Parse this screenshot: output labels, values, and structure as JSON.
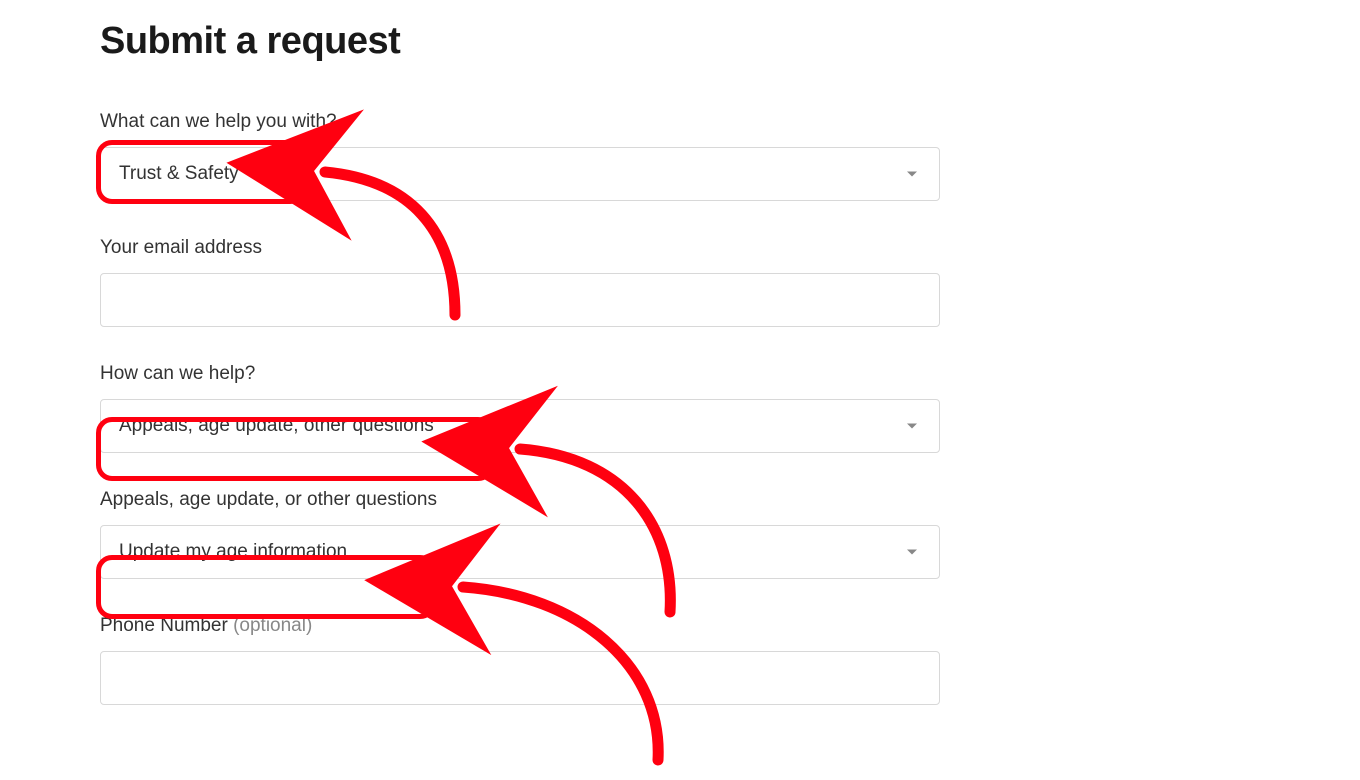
{
  "page": {
    "title": "Submit a request"
  },
  "fields": {
    "help_with": {
      "label": "What can we help you with?",
      "value": "Trust & Safety"
    },
    "email": {
      "label": "Your email address",
      "value": ""
    },
    "how_help": {
      "label": "How can we help?",
      "value": "Appeals, age update, other questions"
    },
    "appeals_sub": {
      "label": "Appeals, age update, or other questions",
      "value": "Update my age information"
    },
    "phone": {
      "label_main": "Phone Number ",
      "label_optional": "(optional)",
      "value": ""
    }
  },
  "annotations": {
    "highlight_color": "#ff0010"
  }
}
